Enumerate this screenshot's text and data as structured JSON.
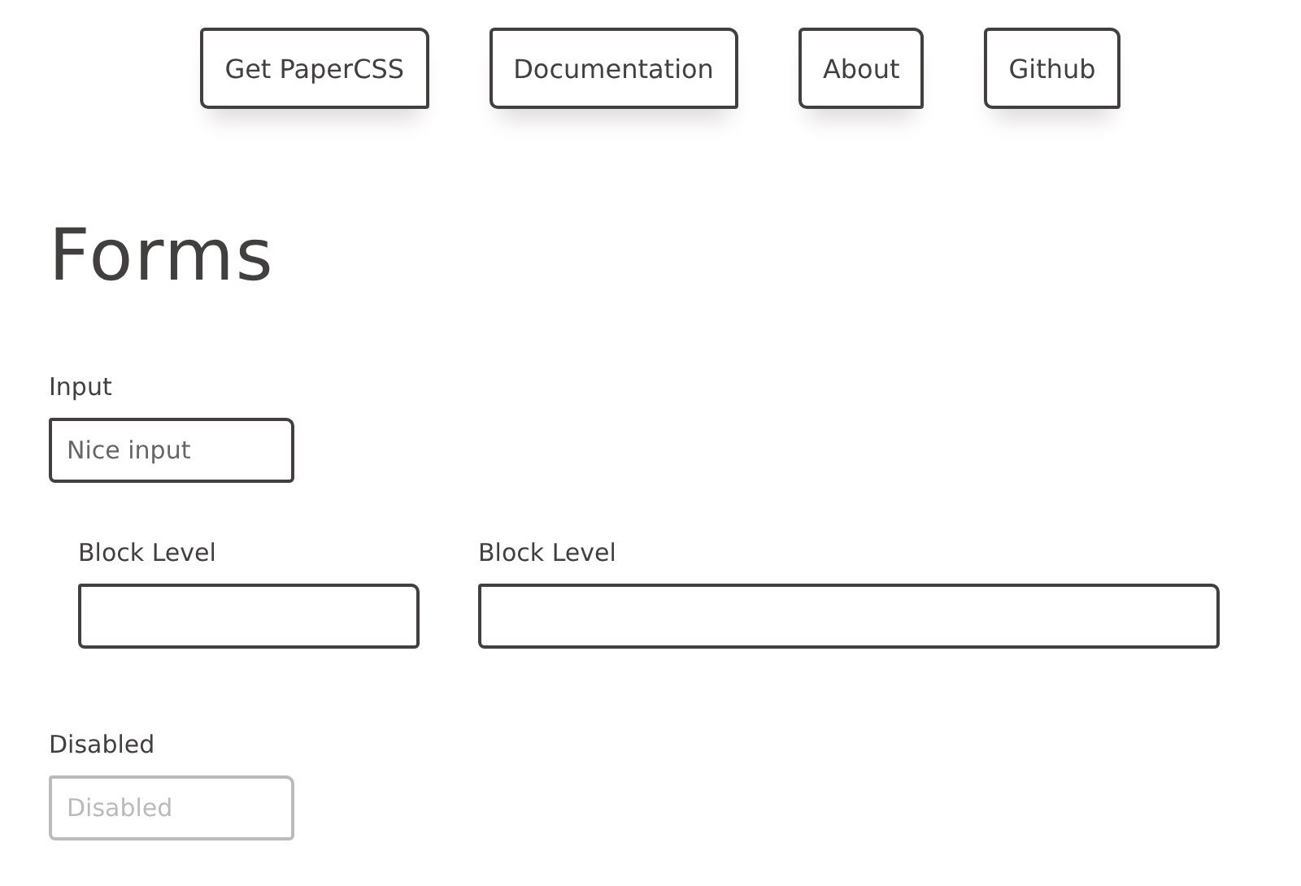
{
  "nav": [
    {
      "label": "Get PaperCSS"
    },
    {
      "label": "Documentation"
    },
    {
      "label": "About"
    },
    {
      "label": "Github"
    }
  ],
  "heading": "Forms",
  "input": {
    "label": "Input",
    "placeholder": "Nice input",
    "disabled": false
  },
  "block_fields": [
    {
      "label": "Block Level",
      "disabled": false
    },
    {
      "label": "Block Level",
      "disabled": false
    }
  ],
  "disabled_field": {
    "label": "Disabled",
    "placeholder": "Disabled",
    "disabled": true
  }
}
